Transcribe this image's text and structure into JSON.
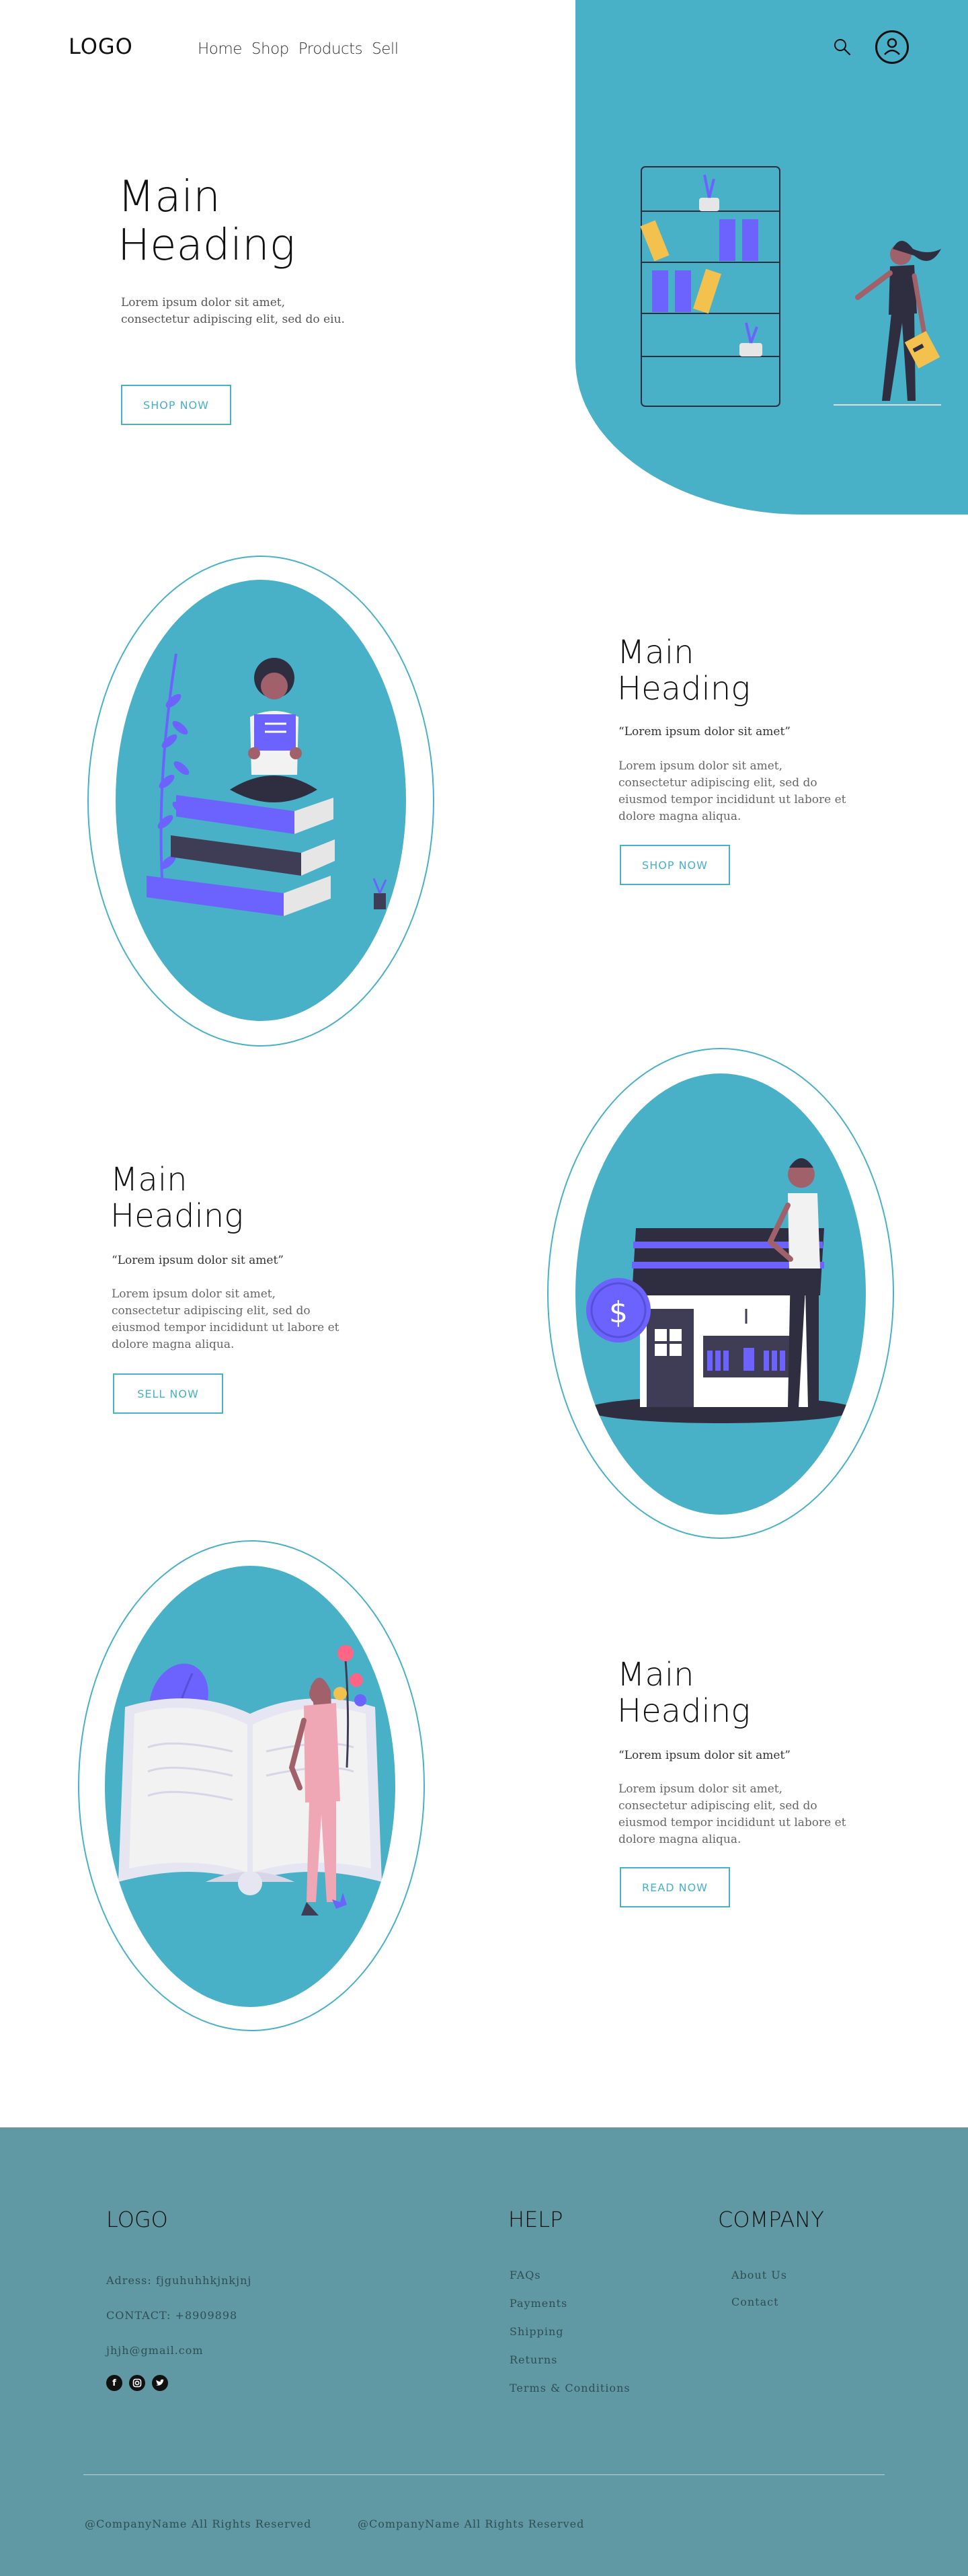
{
  "header": {
    "logo": "LOGO",
    "nav": [
      "Home",
      "Shop",
      "Products",
      "Sell"
    ]
  },
  "hero": {
    "heading_line1": "Main",
    "heading_line2": "Heading",
    "text_line1": "Lorem ipsum dolor sit amet,",
    "text_line2": "consectetur adipiscing elit, sed do eiu.",
    "button": "SHOP NOW"
  },
  "sections": [
    {
      "heading_line1": "Main",
      "heading_line2": "Heading",
      "quote": "“Lorem ipsum dolor sit amet”",
      "body": [
        "Lorem ipsum dolor sit amet,",
        "consectetur adipiscing elit, sed do",
        "eiusmod tempor incididunt ut labore et",
        "dolore magna aliqua."
      ],
      "button": "SHOP NOW"
    },
    {
      "heading_line1": "Main",
      "heading_line2": "Heading",
      "quote": "“Lorem ipsum dolor sit amet”",
      "body": [
        "Lorem ipsum dolor sit amet,",
        "consectetur adipiscing elit, sed do",
        "eiusmod tempor incididunt ut labore et",
        "dolore magna aliqua."
      ],
      "button": "SELL NOW"
    },
    {
      "heading_line1": "Main",
      "heading_line2": "Heading",
      "quote": "“Lorem ipsum dolor sit amet”",
      "body": [
        "Lorem ipsum dolor sit amet,",
        "consectetur adipiscing elit, sed do",
        "eiusmod tempor incididunt ut labore et",
        "dolore magna aliqua."
      ],
      "button": "READ NOW"
    }
  ],
  "footer": {
    "logo": "LOGO",
    "address": "Adress: fjguhuhhkjnkjnj",
    "contact": "CONTACT: +8909898",
    "email": "jhjh@gmail.com",
    "social_icons": [
      "facebook-icon",
      "instagram-icon",
      "twitter-icon"
    ],
    "help_title": "HELP",
    "help_links": [
      "FAQs",
      "Payments",
      "Shipping",
      "Returns",
      "Terms & Conditions"
    ],
    "company_title": "COMPANY",
    "company_links": [
      "About Us",
      "Contact"
    ],
    "copyright_1": "@CompanyName All Rights Reserved",
    "copyright_2": "@CompanyName All Rights Reserved"
  },
  "colors": {
    "accent": "#48b0c7",
    "footer_bg": "#6099a3",
    "illustration_purple": "#6c63ff",
    "illustration_dark": "#2f2e41"
  }
}
